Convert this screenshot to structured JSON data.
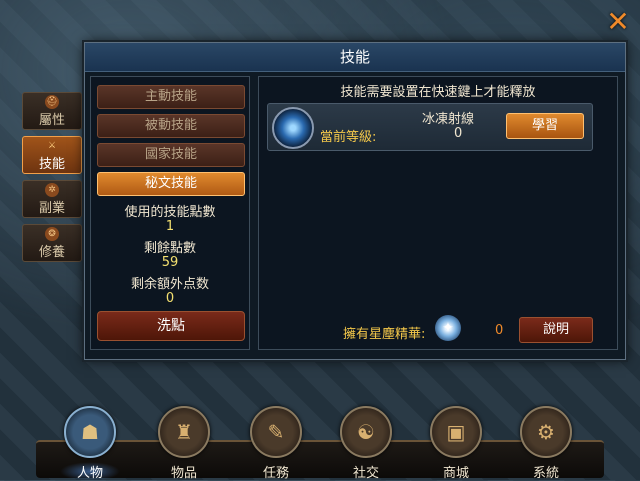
{
  "window": {
    "title": "技能"
  },
  "side_tabs": [
    {
      "label": "屬性",
      "icon": "helmet-icon",
      "active": false
    },
    {
      "label": "技能",
      "icon": "skill-icon",
      "active": true
    },
    {
      "label": "副業",
      "icon": "gear-icon",
      "active": false
    },
    {
      "label": "修養",
      "icon": "emblem-icon",
      "active": false
    }
  ],
  "categories": [
    {
      "label": "主動技能",
      "active": false
    },
    {
      "label": "被動技能",
      "active": false
    },
    {
      "label": "國家技能",
      "active": false
    },
    {
      "label": "秘文技能",
      "active": true
    }
  ],
  "stats": {
    "used_label": "使用的技能點數",
    "used_value": "1",
    "remaining_label": "剩餘點數",
    "remaining_value": "59",
    "extra_label": "剩余額外点数",
    "extra_value": "0"
  },
  "reset_button": "洗點",
  "hint": "技能需要設置在快速鍵上才能釋放",
  "skill": {
    "name": "冰凍射線",
    "level_label": "當前等級:",
    "level_value": "0",
    "learn_button": "學習",
    "icon": "ice-beam-icon"
  },
  "stardust": {
    "label": "擁有星塵精華:",
    "value": "0",
    "explain_button": "說明"
  },
  "nav": [
    {
      "label": "人物",
      "icon": "character-icon",
      "active": true
    },
    {
      "label": "物品",
      "icon": "bag-icon",
      "active": false
    },
    {
      "label": "任務",
      "icon": "scroll-icon",
      "active": false
    },
    {
      "label": "社交",
      "icon": "handshake-icon",
      "active": false
    },
    {
      "label": "商城",
      "icon": "chest-icon",
      "active": false
    },
    {
      "label": "系統",
      "icon": "settings-icon",
      "active": false
    }
  ],
  "colors": {
    "accent": "#e08a2e",
    "header": "#2a4766",
    "highlight_text": "#f4c84a"
  }
}
